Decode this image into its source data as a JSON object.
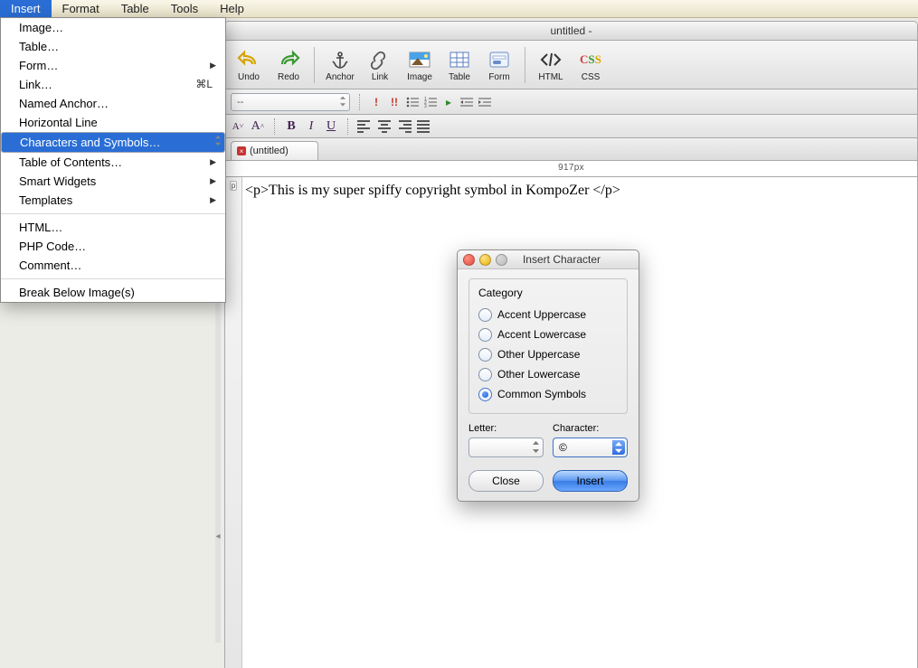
{
  "menubar": [
    "Insert",
    "Format",
    "Table",
    "Tools",
    "Help"
  ],
  "menubar_active_index": 0,
  "insert_menu": {
    "items": [
      {
        "label": "Image…",
        "arrow": false
      },
      {
        "label": "Table…",
        "arrow": false
      },
      {
        "label": "Form…",
        "arrow": true
      },
      {
        "label": "Link…",
        "arrow": false,
        "shortcut": "⌘L"
      },
      {
        "label": "Named Anchor…",
        "arrow": false
      },
      {
        "label": "Horizontal Line",
        "arrow": false
      },
      {
        "label": "Characters and Symbols…",
        "arrow": false,
        "selected": true
      },
      {
        "label": "Table of Contents…",
        "arrow": true
      },
      {
        "label": "Smart Widgets",
        "arrow": true
      },
      {
        "label": "Templates",
        "arrow": true
      },
      {
        "sep": true
      },
      {
        "label": "HTML…",
        "arrow": false
      },
      {
        "label": "PHP Code…",
        "arrow": false
      },
      {
        "label": "Comment…",
        "arrow": false
      },
      {
        "sep": true
      },
      {
        "label": "Break Below Image(s)",
        "arrow": false
      }
    ]
  },
  "window": {
    "title": "untitled -"
  },
  "toolbar1": [
    {
      "name": "undo-button",
      "label": "Undo",
      "icon": "undo"
    },
    {
      "name": "redo-button",
      "label": "Redo",
      "icon": "redo"
    },
    {
      "sep": true
    },
    {
      "name": "anchor-button",
      "label": "Anchor",
      "icon": "anchor"
    },
    {
      "name": "link-button",
      "label": "Link",
      "icon": "link"
    },
    {
      "name": "image-button",
      "label": "Image",
      "icon": "image"
    },
    {
      "name": "table-button",
      "label": "Table",
      "icon": "table"
    },
    {
      "name": "form-button",
      "label": "Form",
      "icon": "form"
    },
    {
      "sep": true
    },
    {
      "name": "html-button",
      "label": "HTML",
      "icon": "html"
    },
    {
      "name": "css-button",
      "label": "CSS",
      "icon": "css"
    }
  ],
  "toolbar2": {
    "para_label": "--",
    "icons": [
      "para-exclaim",
      "para-exclaim2",
      "list-bullet",
      "list-number",
      "arrow-right",
      "indent-left",
      "indent-right"
    ]
  },
  "toolbar3": {
    "font_dec": "A˅",
    "font_inc": "A˄",
    "bold": "B",
    "italic": "I",
    "underline": "U"
  },
  "tab": {
    "label": "(untitled)"
  },
  "ruler": "917px",
  "editor_text": "<p>This is my super spiffy copyright symbol in KompoZer </p>",
  "gutter_tag": "p",
  "dialog": {
    "title": "Insert Character",
    "category_label": "Category",
    "options": [
      {
        "label": "Accent Uppercase",
        "checked": false
      },
      {
        "label": "Accent Lowercase",
        "checked": false
      },
      {
        "label": "Other Uppercase",
        "checked": false
      },
      {
        "label": "Other Lowercase",
        "checked": false
      },
      {
        "label": "Common Symbols",
        "checked": true
      }
    ],
    "letter_label": "Letter:",
    "letter_value": "",
    "character_label": "Character:",
    "character_value": "©",
    "close": "Close",
    "insert": "Insert"
  }
}
